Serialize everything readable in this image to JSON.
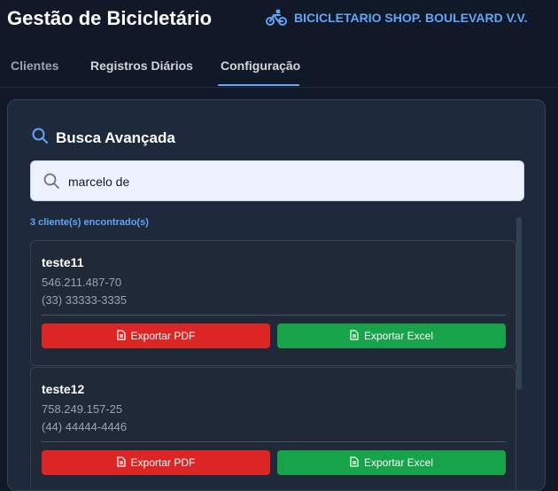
{
  "header": {
    "app_title": "Gestão de Bicicletário",
    "shop_name": "BICICLETARIO SHOP. BOULEVARD V.V.",
    "shop_icon": "bicycle-icon"
  },
  "tabs": [
    {
      "label": "Clientes",
      "active": false
    },
    {
      "label": "Registros Diários",
      "active": false
    },
    {
      "label": "Configuração",
      "active": true
    }
  ],
  "search_panel": {
    "title": "Busca Avançada",
    "title_icon": "search-icon",
    "input_value": "marcelo de",
    "results_count_text": "3 cliente(s) encontrado(s)"
  },
  "results": [
    {
      "name": "teste11",
      "document": "546.211.487-70",
      "phone": "(33) 33333-3335",
      "pdf_label": "Exportar PDF",
      "excel_label": "Exportar Excel"
    },
    {
      "name": "teste12",
      "document": "758.249.157-25",
      "phone": "(44) 44444-4446",
      "pdf_label": "Exportar PDF",
      "excel_label": "Exportar Excel"
    }
  ],
  "colors": {
    "background": "#111827",
    "panel": "#1e293b",
    "accent": "#60a5fa",
    "pdf_button": "#dc2626",
    "excel_button": "#16a34a"
  }
}
